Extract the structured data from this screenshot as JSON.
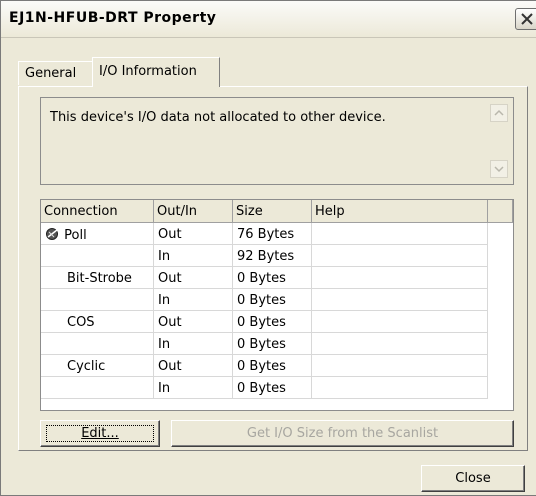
{
  "window": {
    "title": "EJ1N-HFUB-DRT Property"
  },
  "tabs": [
    {
      "label": "General"
    },
    {
      "label": "I/O Information"
    }
  ],
  "message": {
    "text": "This device's I/O data not allocated to other device."
  },
  "table": {
    "columns": [
      "Connection",
      "Out/In",
      "Size",
      "Help"
    ],
    "rows": [
      {
        "connection": "Poll",
        "dir": "Out",
        "size": "76 Bytes",
        "help": ""
      },
      {
        "connection": "",
        "dir": "In",
        "size": "92 Bytes",
        "help": ""
      },
      {
        "connection": "Bit-Strobe",
        "dir": "Out",
        "size": "0 Bytes",
        "help": ""
      },
      {
        "connection": "",
        "dir": "In",
        "size": "0 Bytes",
        "help": ""
      },
      {
        "connection": "COS",
        "dir": "Out",
        "size": "0 Bytes",
        "help": ""
      },
      {
        "connection": "",
        "dir": "In",
        "size": "0 Bytes",
        "help": ""
      },
      {
        "connection": "Cyclic",
        "dir": "Out",
        "size": "0 Bytes",
        "help": ""
      },
      {
        "connection": "",
        "dir": "In",
        "size": "0 Bytes",
        "help": ""
      }
    ]
  },
  "buttons": {
    "edit": "Edit...",
    "get_io_size": "Get I/O Size from the Scanlist",
    "close": "Close"
  },
  "icons": {
    "poll_icon": "connection-icon",
    "window_close": "close-icon"
  }
}
